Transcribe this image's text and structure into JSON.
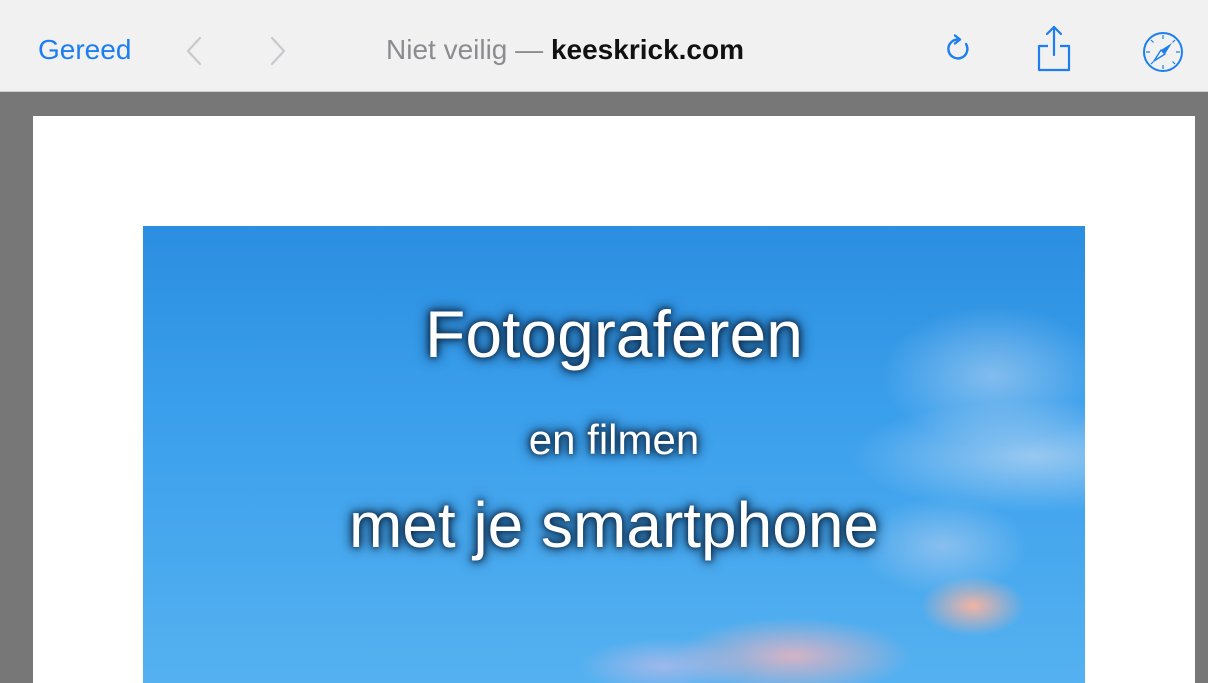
{
  "toolbar": {
    "done_label": "Gereed",
    "address_insecure": "Niet veilig",
    "address_separator": "—",
    "address_domain": "keeskrick.com",
    "accent_color": "#1c7ef0",
    "icons": {
      "back": "chevron-left-icon",
      "forward": "chevron-right-icon",
      "reload": "reload-icon",
      "share": "share-icon",
      "safari": "compass-icon"
    }
  },
  "page": {
    "banner": {
      "title": "Fotograferen",
      "subtitle": "en filmen",
      "tagline": "met je smartphone"
    }
  }
}
